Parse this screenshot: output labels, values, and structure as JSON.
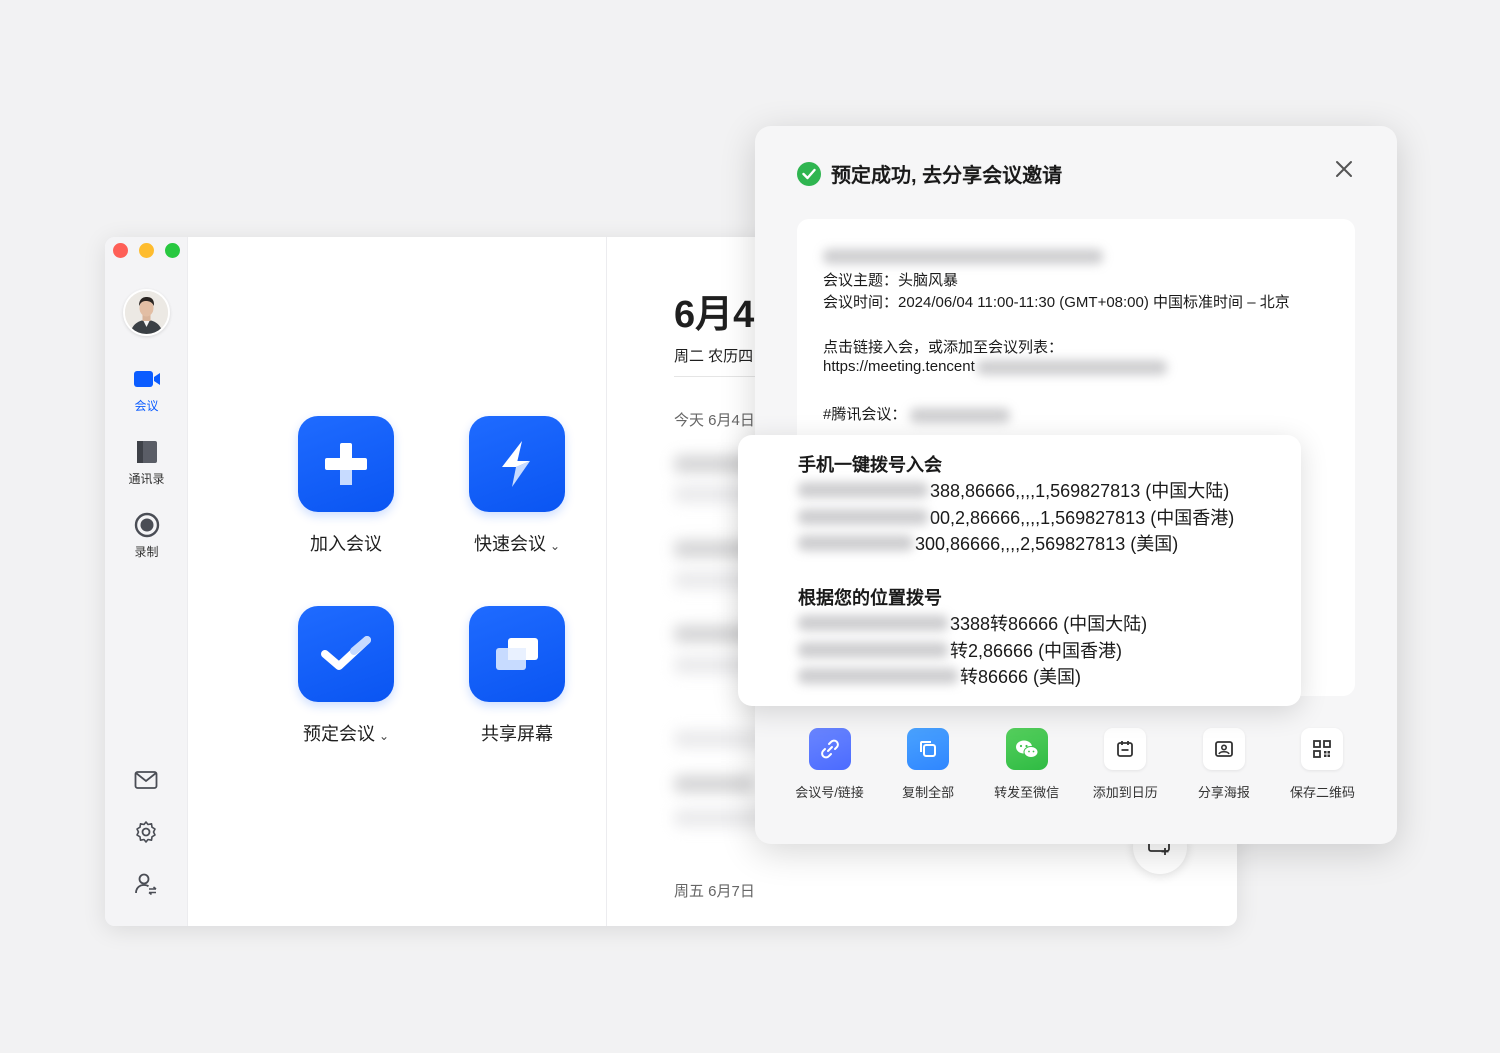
{
  "sidebar": {
    "nav": [
      {
        "label": "会议",
        "icon": "video-camera-icon"
      },
      {
        "label": "通讯录",
        "icon": "contacts-book-icon"
      },
      {
        "label": "录制",
        "icon": "record-icon"
      }
    ],
    "bottom_icons": [
      "mail-icon",
      "settings-gear-icon",
      "user-switch-icon"
    ]
  },
  "actions": [
    {
      "label": "加入会议",
      "icon": "plus-icon"
    },
    {
      "label": "快速会议",
      "icon": "lightning-icon",
      "caret": "⌄"
    },
    {
      "label": "预定会议",
      "icon": "check-icon",
      "caret": "⌄"
    },
    {
      "label": "共享屏幕",
      "icon": "share-screen-icon"
    }
  ],
  "schedule": {
    "date_big": "6月4",
    "date_sub": "周二 农历四",
    "today_label": "今天 6月4日",
    "friday_label": "周五 6月7日"
  },
  "modal": {
    "title": "预定成功, 去分享会议邀请",
    "invite": {
      "topic": "会议主题：头脑风暴",
      "time": "会议时间：2024/06/04 11:00-11:30 (GMT+08:00) 中国标准时间 – 北京",
      "join_hint": "点击链接入会，或添加至会议列表：",
      "link": "https://meeting.tencent",
      "meeting_id_label": "#腾讯会议："
    },
    "share_actions": [
      {
        "label": "会议号/链接",
        "icon": "link-icon"
      },
      {
        "label": "复制全部",
        "icon": "copy-icon"
      },
      {
        "label": "转发至微信",
        "icon": "wechat-icon"
      },
      {
        "label": "添加到日历",
        "icon": "calendar-icon"
      },
      {
        "label": "分享海报",
        "icon": "image-poster-icon"
      },
      {
        "label": "保存二维码",
        "icon": "qr-code-icon"
      }
    ]
  },
  "dial": {
    "one_tap_heading": "手机一键拨号入会",
    "one_tap": [
      {
        "visible": "388,86666,,,,1,569827813 (中国大陆)"
      },
      {
        "visible": "00,2,86666,,,,1,569827813 (中国香港)"
      },
      {
        "visible": "300,86666,,,,2,569827813 (美国)"
      }
    ],
    "location_heading": "根据您的位置拨号",
    "location": [
      {
        "visible": "3388转86666 (中国大陆)"
      },
      {
        "visible": "转2,86666 (中国香港)"
      },
      {
        "visible": "转86666 (美国)"
      }
    ]
  },
  "colors": {
    "brand_blue": "#0b5cff",
    "success_green": "#2fb550"
  }
}
